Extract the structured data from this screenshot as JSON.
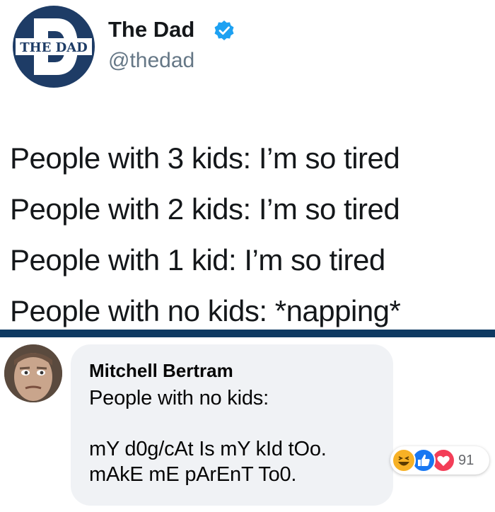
{
  "tweet": {
    "author_name": "The Dad",
    "author_handle": "@thedad",
    "logo_text": "THE DAD",
    "logo_letter": "D",
    "lines": [
      "People with 3 kids: I’m so tired",
      "People with 2 kids: I’m so tired",
      "People with 1 kid: I’m so tired",
      "People with no kids: *napping*"
    ]
  },
  "comment": {
    "author": "Mitchell Bertram",
    "text": "People with no kids:\n\nmY d0g/cAt Is mY kId tOo.\nmAkE mE pArEnT To0.",
    "reaction_count": "91",
    "reactions": [
      "haha-icon",
      "like-icon",
      "love-icon"
    ]
  },
  "colors": {
    "brand_navy": "#1e3c66",
    "divider": "#0f3a62",
    "verified_blue": "#1da1f2",
    "bubble": "#f0f2f5",
    "like": "#1877f2",
    "love": "#f33e58",
    "haha": "#f7b125"
  }
}
